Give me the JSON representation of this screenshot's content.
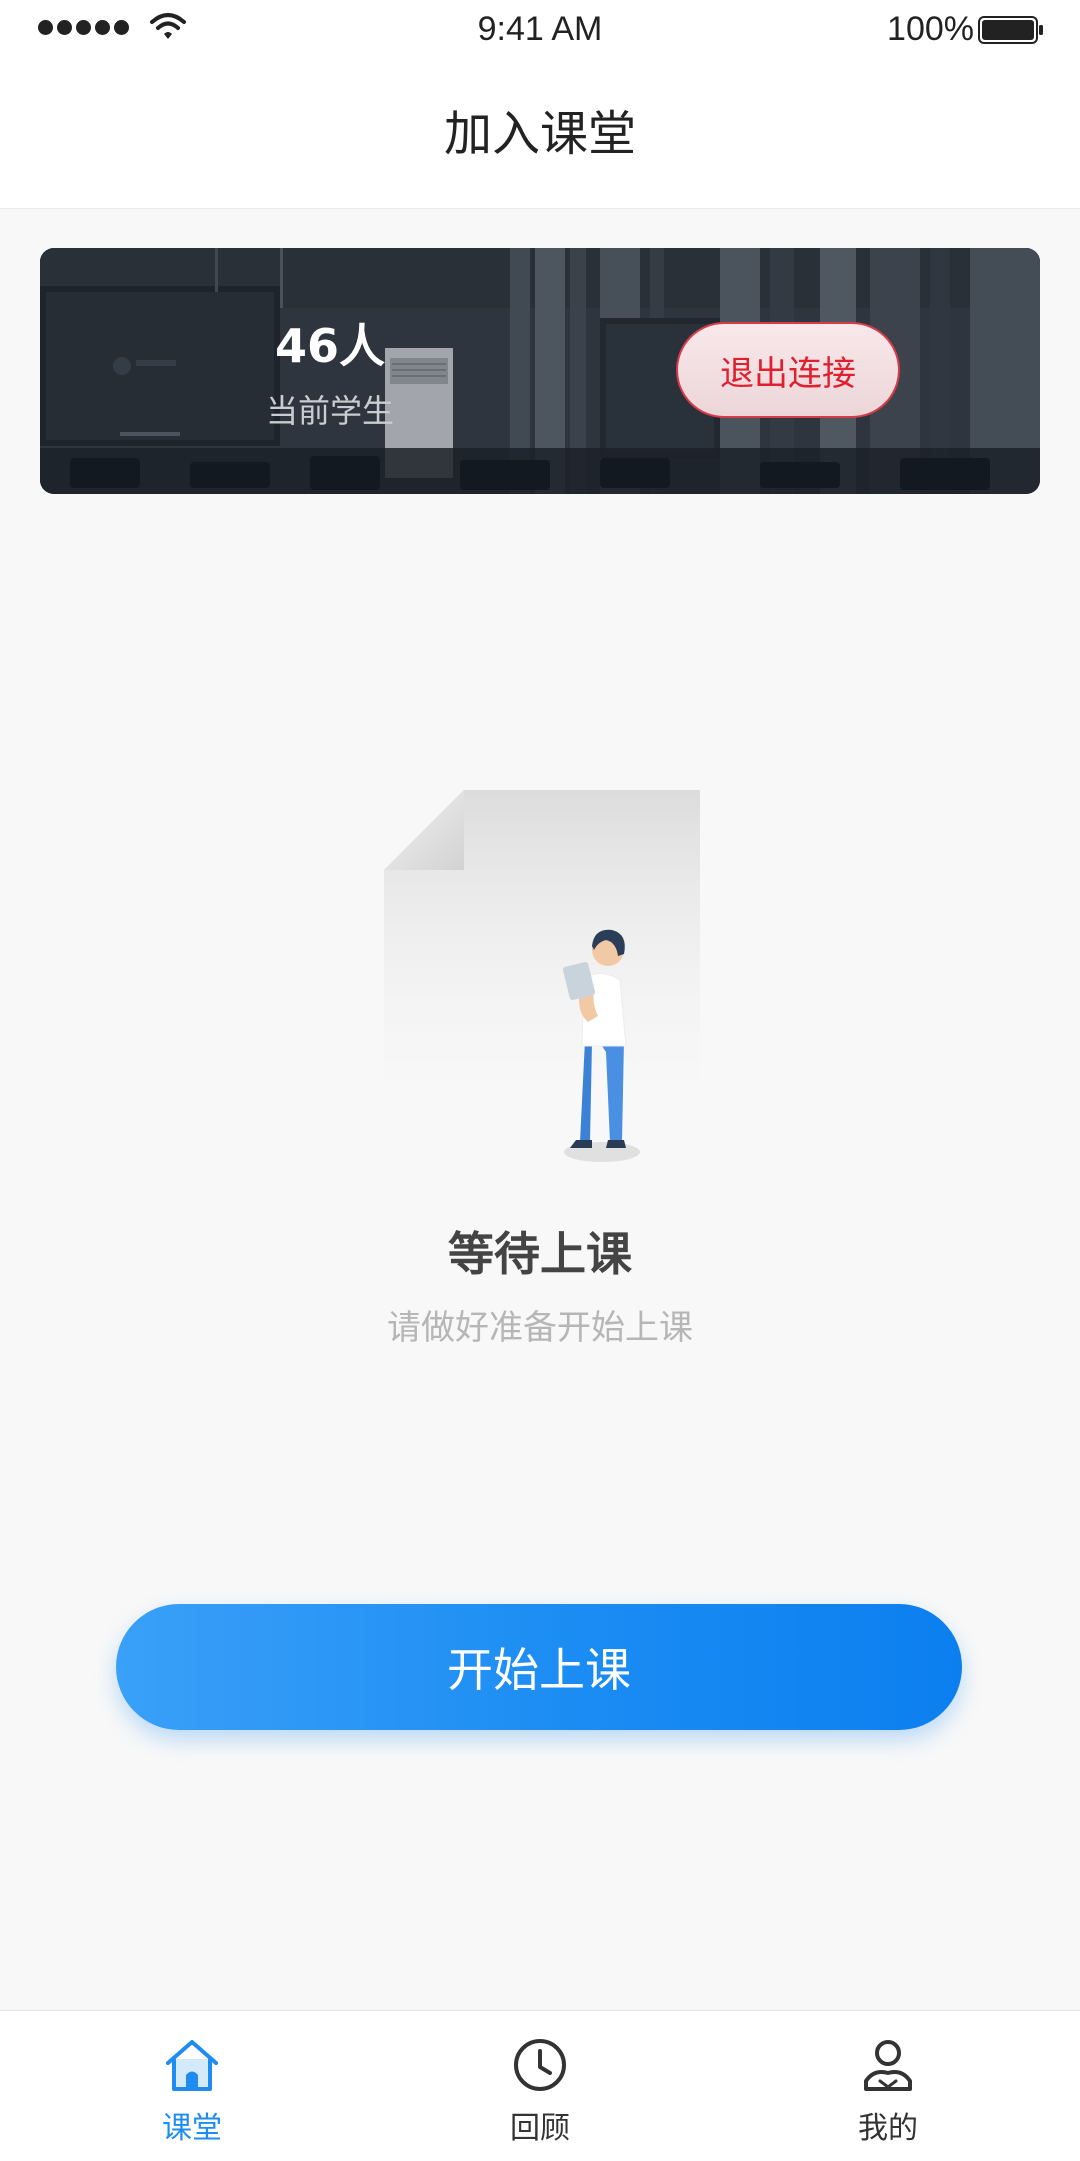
{
  "status_bar": {
    "time": "9:41 AM",
    "battery": "100%"
  },
  "nav": {
    "title": "加入课堂"
  },
  "class_card": {
    "student_count": "46人",
    "student_count_label": "当前学生",
    "exit_button_label": "退出连接"
  },
  "empty_state": {
    "illustration_icon": "person-reading-document-icon",
    "title": "等待上课",
    "subtitle": "请做好准备开始上课"
  },
  "start_button": {
    "label": "开始上课"
  },
  "tab_bar": {
    "items": [
      {
        "label": "课堂",
        "icon": "home-icon",
        "active": true
      },
      {
        "label": "回顾",
        "icon": "clock-icon",
        "active": false
      },
      {
        "label": "我的",
        "icon": "user-icon",
        "active": false
      }
    ]
  },
  "colors": {
    "accent": "#1e8cf0",
    "danger": "#e0202f",
    "background": "#f8f8f8"
  }
}
